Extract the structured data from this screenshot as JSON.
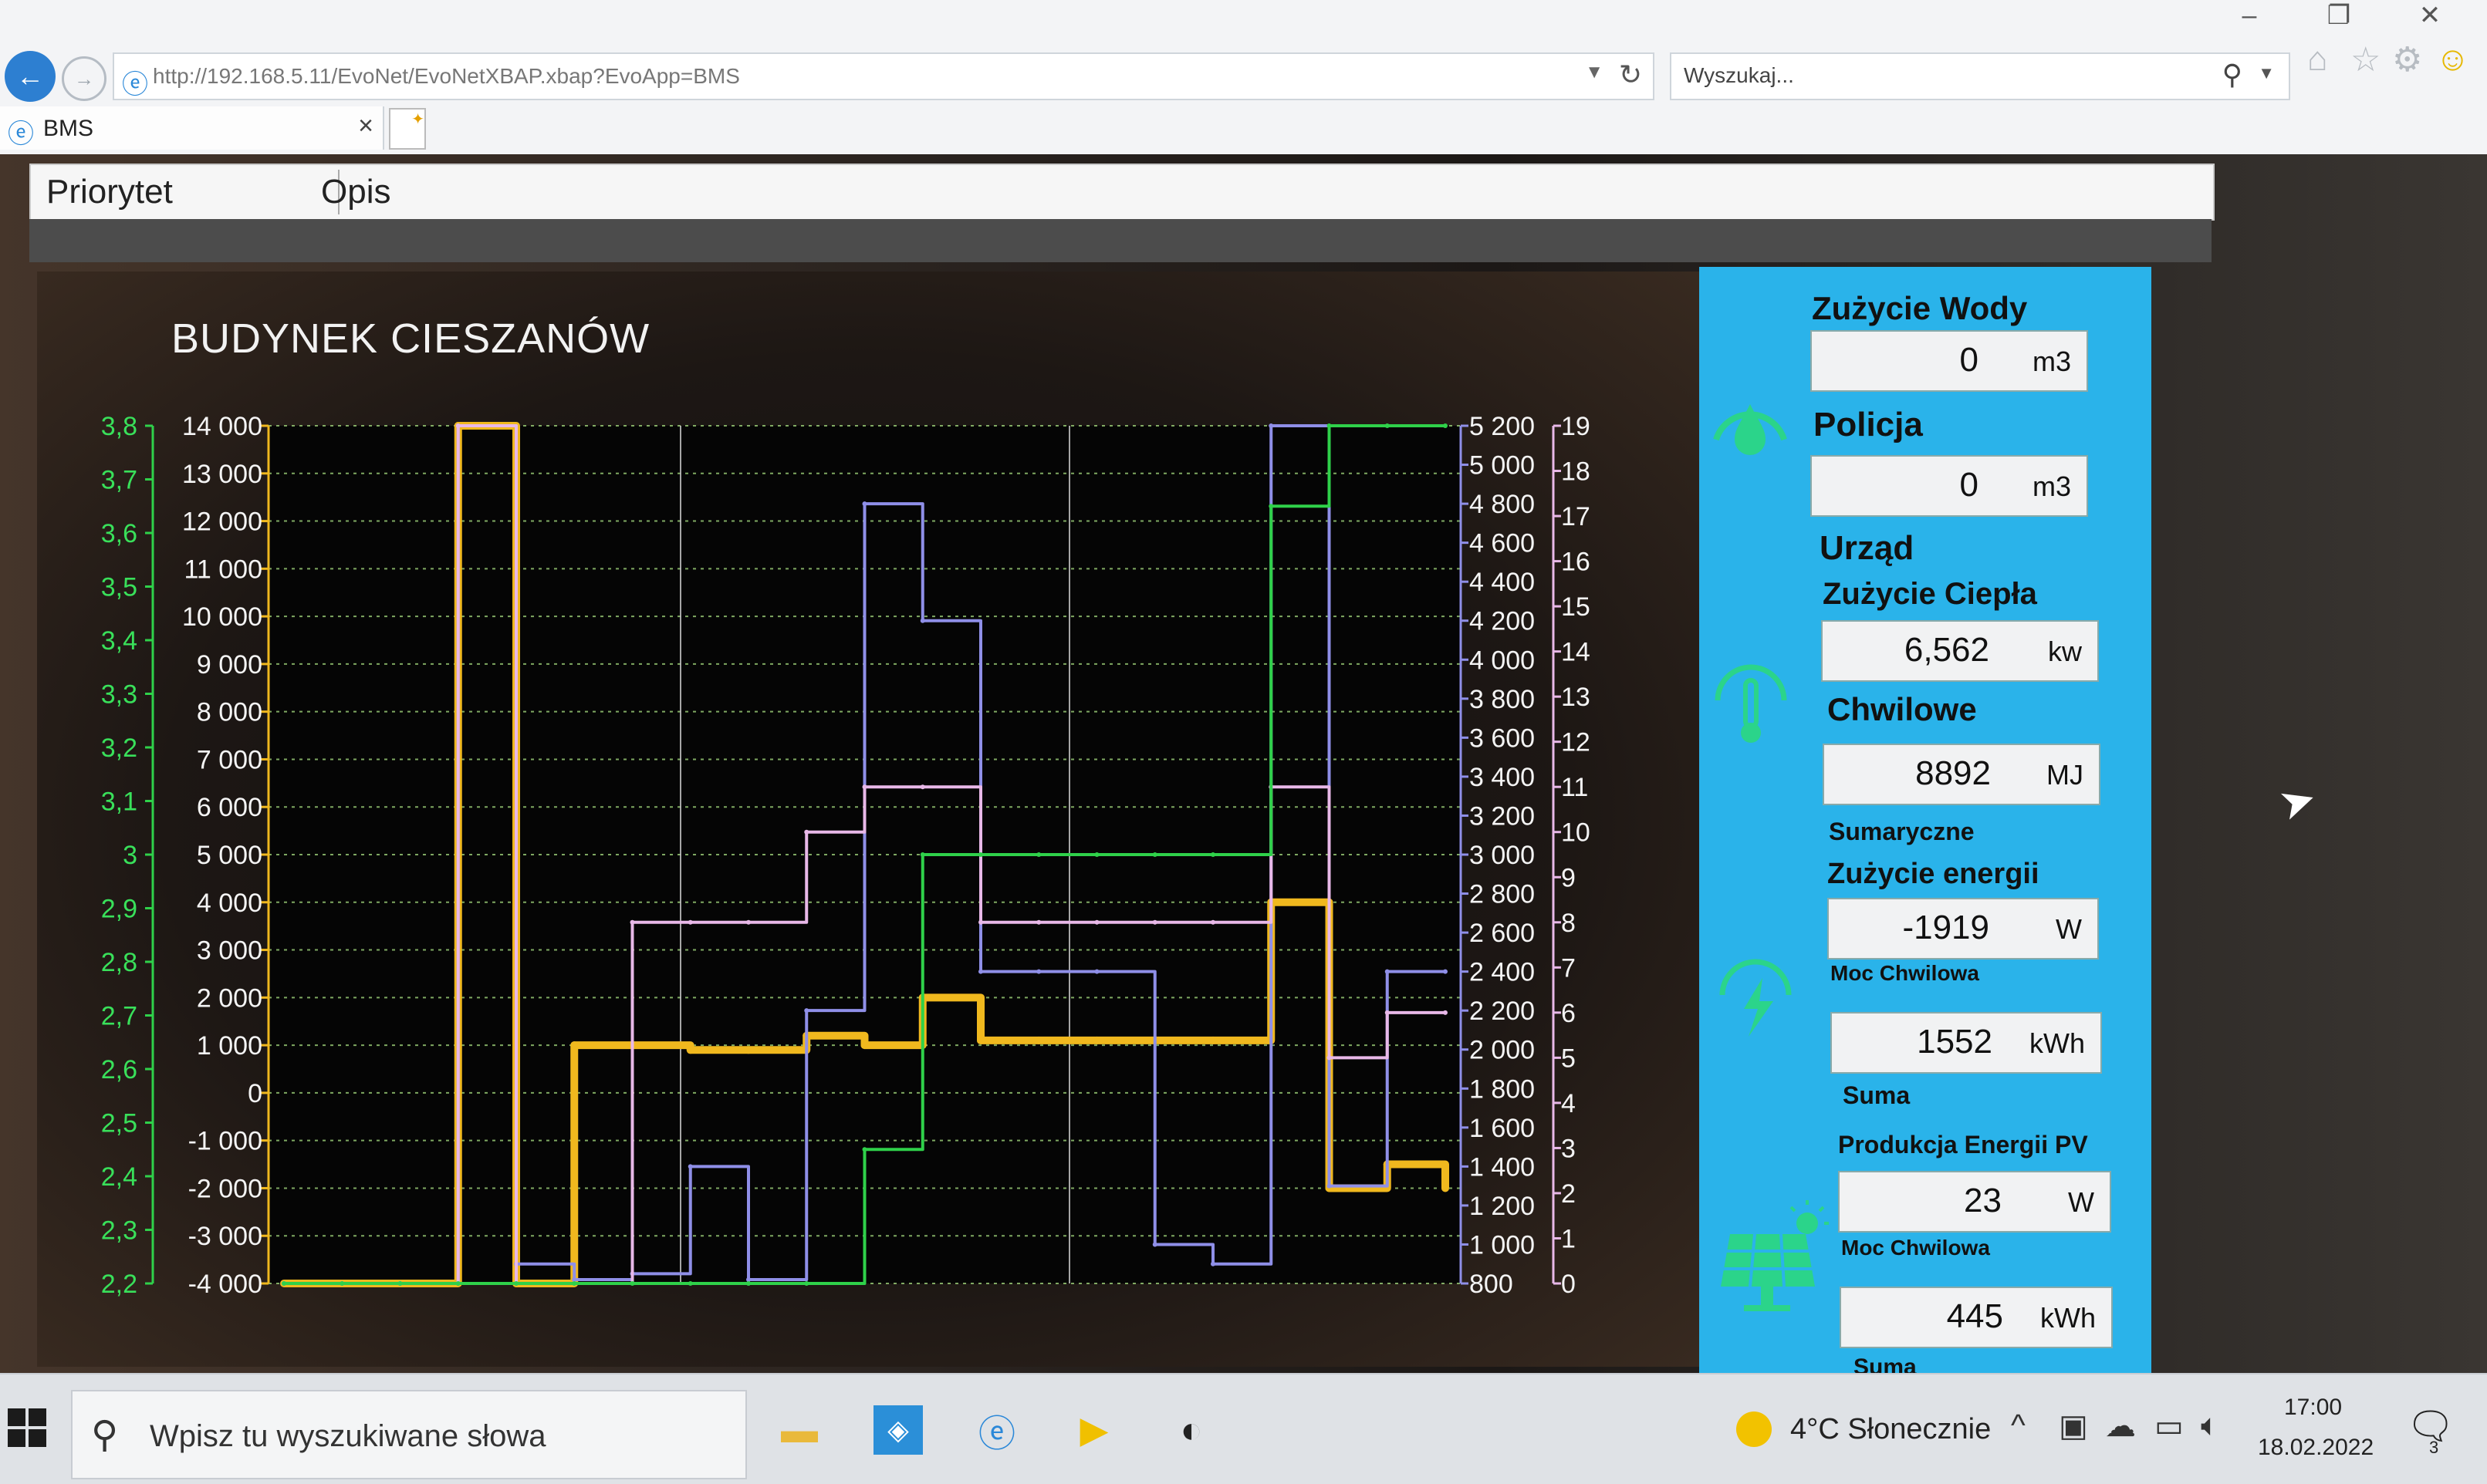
{
  "browser": {
    "url": "http://192.168.5.11/EvoNet/EvoNetXBAP.xbap?EvoApp=BMS",
    "search_placeholder": "Wyszukaj...",
    "tab_title": "BMS"
  },
  "menu": {
    "priority": "Priorytet",
    "description": "Opis"
  },
  "chart": {
    "title": "BUDYNEK CIESZANÓW"
  },
  "chart_data": {
    "type": "line",
    "title": "BUDYNEK CIESZANÓW",
    "x": [
      0,
      1,
      2,
      3,
      4,
      5,
      6,
      7,
      8,
      9,
      10,
      11,
      12,
      13,
      14,
      15,
      16,
      17,
      18,
      19,
      20
    ],
    "axes": [
      {
        "position": "far-left",
        "color": "#2fd14a",
        "ticks": [
          "3,8",
          "3,7",
          "3,6",
          "3,5",
          "3,4",
          "3,3",
          "3,2",
          "3,1",
          "3",
          "2,9",
          "2,8",
          "2,7",
          "2,6",
          "2,5",
          "2,4",
          "2,3",
          "2,2"
        ],
        "range": [
          2.2,
          3.8
        ]
      },
      {
        "position": "left",
        "color": "#f0b81e",
        "ticks": [
          "14 000",
          "13 000",
          "12 000",
          "11 000",
          "10 000",
          "9 000",
          "8 000",
          "7 000",
          "6 000",
          "5 000",
          "4 000",
          "3 000",
          "2 000",
          "1 000",
          "0",
          "-1 000",
          "-2 000",
          "-3 000",
          "-4 000"
        ],
        "range": [
          -4000,
          14000
        ]
      },
      {
        "position": "right",
        "color": "#8f8fe8",
        "ticks": [
          "5 200",
          "5 000",
          "4 800",
          "4 600",
          "4 400",
          "4 200",
          "4 000",
          "3 800",
          "3 600",
          "3 400",
          "3 200",
          "3 000",
          "2 800",
          "2 600",
          "2 400",
          "2 200",
          "2 000",
          "1 800",
          "1 600",
          "1 400",
          "1 200",
          "1 000",
          "800"
        ],
        "range": [
          800,
          5200
        ]
      },
      {
        "position": "far-right",
        "color": "#e8b8e8",
        "ticks": [
          "19",
          "18",
          "17",
          "16",
          "15",
          "14",
          "13",
          "12",
          "11",
          "10",
          "9",
          "8",
          "7",
          "6",
          "5",
          "4",
          "3",
          "2",
          "1",
          "0"
        ],
        "range": [
          0,
          19
        ]
      }
    ],
    "grid": true,
    "series": [
      {
        "color": "#f0b81e",
        "axis": 1,
        "values": [
          -4000,
          -4000,
          -4000,
          14000,
          -4000,
          1000,
          1000,
          900,
          900,
          1200,
          1000,
          2000,
          1100,
          1100,
          1100,
          1100,
          1100,
          4000,
          -2000,
          -1500,
          -2000
        ]
      },
      {
        "color": "#8f8fe8",
        "axis": 2,
        "values": [
          800,
          800,
          800,
          5200,
          900,
          820,
          850,
          1400,
          820,
          2200,
          4800,
          4200,
          2400,
          2400,
          2400,
          1000,
          900,
          5200,
          1300,
          2400,
          2400
        ]
      },
      {
        "color": "#e8b8e8",
        "axis": 3,
        "values": [
          0,
          0,
          0,
          19,
          0,
          0,
          8,
          8,
          8,
          10,
          11,
          11,
          8,
          8,
          8,
          8,
          8,
          11,
          5,
          6,
          6
        ]
      },
      {
        "color": "#2fd14a",
        "axis": 0,
        "values": [
          2.2,
          2.2,
          2.2,
          2.2,
          2.2,
          2.2,
          2.2,
          2.2,
          2.2,
          2.2,
          2.45,
          3.0,
          3.0,
          3.0,
          3.0,
          3.0,
          3.0,
          3.65,
          3.8,
          3.8,
          3.8
        ]
      }
    ]
  },
  "info": {
    "water_title": "Zużycie Wody",
    "water_police_title": "Policja",
    "water_police_value": "0",
    "water_police_unit": "m3",
    "water_value": "0",
    "water_unit": "m3",
    "office_title": "Urząd",
    "heat_title": "Zużycie Ciepła",
    "heat_value": "6,562",
    "heat_unit": "kw",
    "heat_instant_label": "Chwilowe",
    "heat_sum_value": "8892",
    "heat_sum_unit": "MJ",
    "heat_sum_label": "Sumaryczne",
    "energy_title": "Zużycie energii",
    "energy_value": "-1919",
    "energy_unit": "W",
    "energy_instant_label": "Moc Chwilowa",
    "energy_sum_value": "1552",
    "energy_sum_unit": "kWh",
    "energy_sum_label": "Suma",
    "pv_title": "Produkcja Energii PV",
    "pv_value": "23",
    "pv_unit": "W",
    "pv_instant_label": "Moc Chwilowa",
    "pv_sum_value": "445",
    "pv_sum_unit": "kWh",
    "pv_sum_label": "Suma"
  },
  "taskbar": {
    "search_placeholder": "Wpisz tu wyszukiwane słowa",
    "weather": "4°C  Słonecznie",
    "time": "17:00",
    "date": "18.02.2022",
    "notification_count": "3"
  },
  "icons": {
    "back": "back-arrow-icon",
    "forward": "forward-arrow-icon",
    "refresh": "refresh-icon",
    "search": "search-icon",
    "home": "home-icon",
    "favorites": "star-icon",
    "settings": "gear-icon",
    "feedback": "smiley-icon"
  }
}
